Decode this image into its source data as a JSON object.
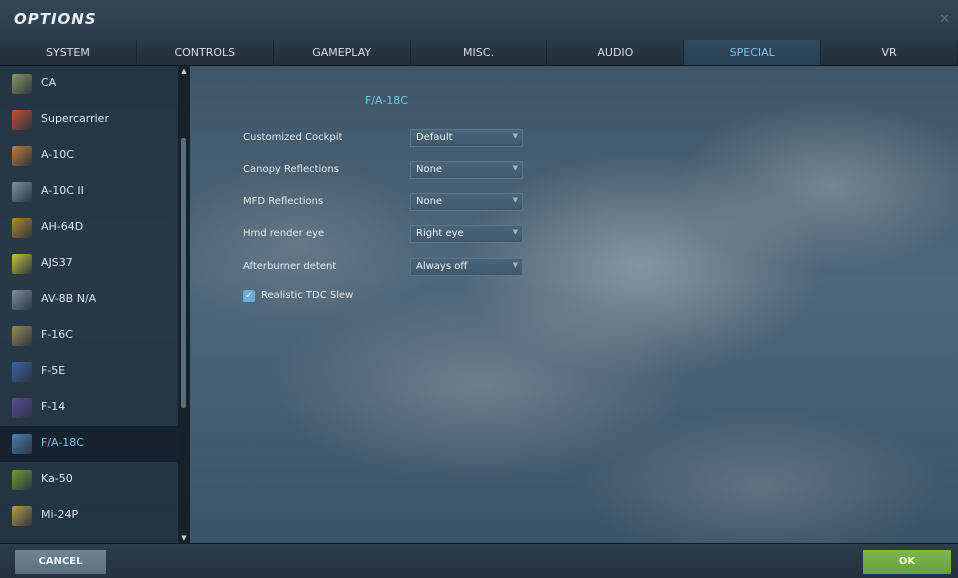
{
  "window": {
    "title": "OPTIONS",
    "close_glyph": "✕"
  },
  "tabs": [
    {
      "label": "SYSTEM",
      "active": false
    },
    {
      "label": "CONTROLS",
      "active": false
    },
    {
      "label": "GAMEPLAY",
      "active": false
    },
    {
      "label": "MISC.",
      "active": false
    },
    {
      "label": "AUDIO",
      "active": false
    },
    {
      "label": "SPECIAL",
      "active": true
    },
    {
      "label": "VR",
      "active": false
    }
  ],
  "sidebar": {
    "items": [
      {
        "label": "CA",
        "icon": "ca-module-icon",
        "color": "#8a9a5a"
      },
      {
        "label": "Supercarrier",
        "icon": "supercarrier-module-icon",
        "color": "#c0532f"
      },
      {
        "label": "A-10C",
        "icon": "a10c-module-icon",
        "color": "#c77a3a"
      },
      {
        "label": "A-10C II",
        "icon": "a10c2-module-icon",
        "color": "#7c93a6"
      },
      {
        "label": "AH-64D",
        "icon": "ah64d-module-icon",
        "color": "#b8862f"
      },
      {
        "label": "AJS37",
        "icon": "ajs37-module-icon",
        "color": "#c6c23a"
      },
      {
        "label": "AV-8B N/A",
        "icon": "av8b-module-icon",
        "color": "#7e8f9c"
      },
      {
        "label": "F-16C",
        "icon": "f16c-module-icon",
        "color": "#9a8a5a"
      },
      {
        "label": "F-5E",
        "icon": "f5e-module-icon",
        "color": "#3e62a8"
      },
      {
        "label": "F-14",
        "icon": "f14-module-icon",
        "color": "#5a4a9a"
      },
      {
        "label": "F/A-18C",
        "icon": "fa18c-module-icon",
        "color": "#4a7fb0",
        "active": true
      },
      {
        "label": "Ka-50",
        "icon": "ka50-module-icon",
        "color": "#6f9a3a"
      },
      {
        "label": "Mi-24P",
        "icon": "mi24p-module-icon",
        "color": "#b89a4a"
      }
    ]
  },
  "panel": {
    "title": "F/A-18C",
    "options": [
      {
        "label": "Customized Cockpit",
        "value": "Default"
      },
      {
        "label": "Canopy Reflections",
        "value": "None"
      },
      {
        "label": "MFD Reflections",
        "value": "None"
      },
      {
        "label": "Hmd render eye",
        "value": "Right eye"
      },
      {
        "label": "Afterburner detent",
        "value": "Always off"
      }
    ],
    "checkbox": {
      "label": "Realistic TDC Slew",
      "checked": true,
      "glyph": "✓"
    }
  },
  "buttons": {
    "cancel": "CANCEL",
    "ok": "OK"
  },
  "colors": {
    "accent": "#7fc3e8",
    "ok_button": "#72ac45",
    "cancel_button": "#647888"
  }
}
